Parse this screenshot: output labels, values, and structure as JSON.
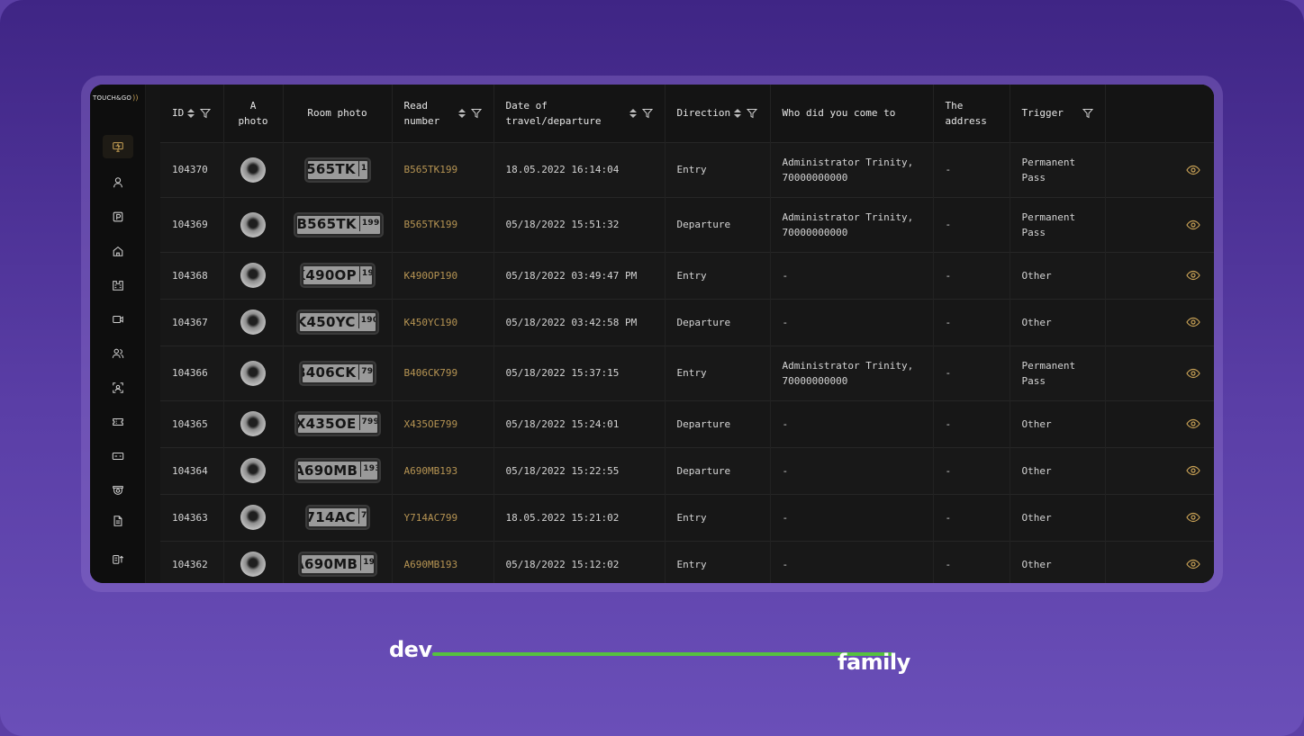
{
  "app": {
    "logo_text": "TOUCH&GO",
    "brand_color": "#c7a055"
  },
  "sidebar": {
    "items": [
      {
        "icon": "monitor-icon",
        "active": true
      },
      {
        "icon": "user-icon"
      },
      {
        "icon": "parking-icon"
      },
      {
        "icon": "home-icon"
      },
      {
        "icon": "building-icon"
      },
      {
        "icon": "camera-icon"
      },
      {
        "icon": "users-icon"
      },
      {
        "icon": "face-scan-icon"
      },
      {
        "icon": "ticket-icon"
      },
      {
        "icon": "card-icon"
      },
      {
        "icon": "cctv-icon"
      },
      {
        "icon": "document-icon"
      },
      {
        "icon": "export-icon"
      }
    ]
  },
  "table": {
    "headers": {
      "id": "ID",
      "photo": "A photo",
      "room_photo": "Room photo",
      "read_number": "Read number",
      "date": "Date of travel/departure",
      "direction": "Direction",
      "who": "Who did you come to",
      "address": "The address",
      "trigger": "Trigger"
    },
    "rows": [
      {
        "id": "104370",
        "plate_main": "B565TK",
        "plate_region": "199",
        "read_number": "B565TK199",
        "date": "18.05.2022 16:14:04",
        "direction": "Entry",
        "who": "Administrator Trinity, 70000000000",
        "address": "-",
        "trigger": "Permanent Pass"
      },
      {
        "id": "104369",
        "plate_main": "B565TK",
        "plate_region": "199",
        "read_number": "B565TK199",
        "date": "05/18/2022 15:51:32",
        "direction": "Departure",
        "who": "Administrator Trinity, 70000000000",
        "address": "-",
        "trigger": "Permanent Pass"
      },
      {
        "id": "104368",
        "plate_main": "K490OP",
        "plate_region": "190",
        "read_number": "K490OP190",
        "date": "05/18/2022 03:49:47 PM",
        "direction": "Entry",
        "who": "-",
        "address": "-",
        "trigger": "Other"
      },
      {
        "id": "104367",
        "plate_main": "K450YC",
        "plate_region": "190",
        "read_number": "K450YC190",
        "date": "05/18/2022 03:42:58 PM",
        "direction": "Departure",
        "who": "-",
        "address": "-",
        "trigger": "Other"
      },
      {
        "id": "104366",
        "plate_main": "B406CK",
        "plate_region": "799",
        "read_number": "B406CK799",
        "date": "05/18/2022 15:37:15",
        "direction": "Entry",
        "who": "Administrator Trinity, 70000000000",
        "address": "-",
        "trigger": "Permanent Pass"
      },
      {
        "id": "104365",
        "plate_main": "X435OE",
        "plate_region": "799",
        "read_number": "X435OE799",
        "date": "05/18/2022 15:24:01",
        "direction": "Departure",
        "who": "-",
        "address": "-",
        "trigger": "Other"
      },
      {
        "id": "104364",
        "plate_main": "A690MB",
        "plate_region": "193",
        "read_number": "A690MB193",
        "date": "05/18/2022 15:22:55",
        "direction": "Departure",
        "who": "-",
        "address": "-",
        "trigger": "Other"
      },
      {
        "id": "104363",
        "plate_main": "Y714AC",
        "plate_region": "799",
        "read_number": "Y714AC799",
        "date": "18.05.2022 15:21:02",
        "direction": "Entry",
        "who": "-",
        "address": "-",
        "trigger": "Other"
      },
      {
        "id": "104362",
        "plate_main": "A690MB",
        "plate_region": "193",
        "read_number": "A690MB193",
        "date": "05/18/2022 15:12:02",
        "direction": "Entry",
        "who": "-",
        "address": "-",
        "trigger": "Other"
      }
    ]
  },
  "footer_logo": {
    "left": "dev",
    "right": "family",
    "line_color": "#56c13f"
  }
}
